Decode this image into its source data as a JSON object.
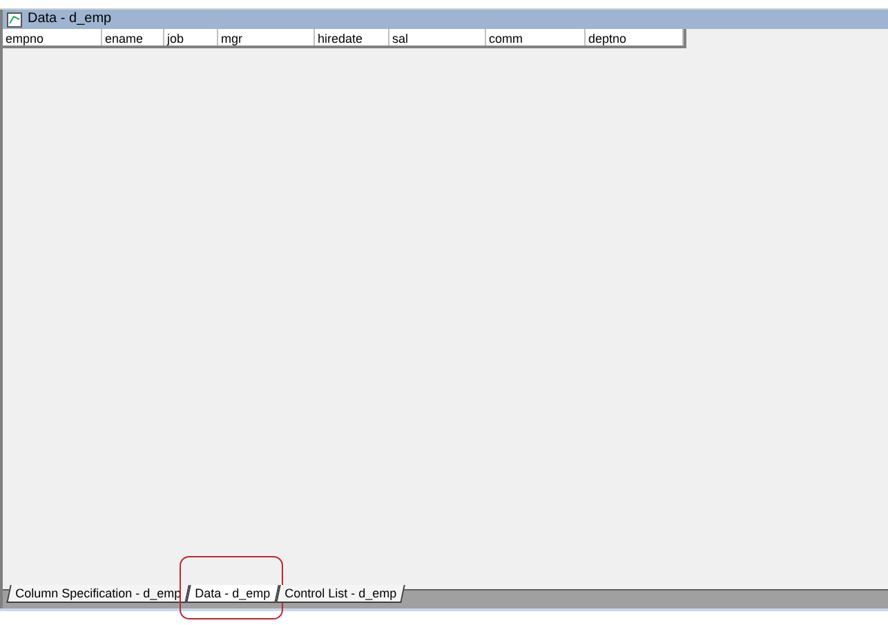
{
  "panel": {
    "title": "Data - d_emp"
  },
  "columns": [
    {
      "label": "empno"
    },
    {
      "label": "ename"
    },
    {
      "label": "job"
    },
    {
      "label": "mgr"
    },
    {
      "label": "hiredate"
    },
    {
      "label": "sal"
    },
    {
      "label": "comm"
    },
    {
      "label": "deptno"
    }
  ],
  "tabs": [
    {
      "label": "Column Specification - d_emp",
      "selected": false
    },
    {
      "label": "Data - d_emp",
      "selected": true
    },
    {
      "label": "Control List - d_emp",
      "selected": false
    }
  ]
}
